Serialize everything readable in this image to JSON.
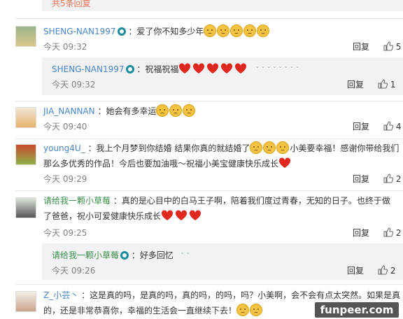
{
  "top": {
    "more": "共5条回复"
  },
  "comments": [
    {
      "user": "SHENG-NAN1997",
      "text": "：爱了你不知多少年",
      "time": "今天 09:32",
      "reply": "回复",
      "likes": "5"
    },
    {
      "user": "SHENG-NAN1997",
      "text": "：祝福祝福",
      "time": "今天 09:32",
      "reply": "回复",
      "likes": "1"
    },
    {
      "user": "JIA_NANNAN",
      "text": "：她会有多幸运",
      "time": "今天 09:40",
      "reply": "回复",
      "likes": "4"
    },
    {
      "user": "young4U_",
      "text1": "：我上个月梦到你结婚 结果你真的就结婚了",
      "text2": "小美要幸福！感谢你带给我们",
      "text3": "那么多优秀的作品！今后也要加油哦～祝福小美宝健康快乐成长",
      "time": "今天 09:29",
      "reply": "回复",
      "likes": "2"
    },
    {
      "user": "请给我一颗小草莓",
      "text1": "：真的是心目中的白马王子啊，陪着我们度过青春，无知的日子。也终于做",
      "text2": "了爸爸，祝小可爱健康快乐成长",
      "time": "今天 09:25",
      "reply": "回复",
      "likes": "2"
    },
    {
      "user": "请给我一颗小草莓",
      "text": "：好多回忆",
      "time": "今天 09:26",
      "reply": "回复",
      "likes": "2"
    },
    {
      "user": "Z_小芸丶",
      "text1": "：这是真的吗，是真的吗，真的吗，的吗，吗？小美啊，会不会有点太突然。如果是真",
      "text2": "的，还是非常恭喜你，幸福的生活会一直继续下去！"
    }
  ],
  "watermark": "funpeer.com",
  "colors": {
    "accent": "#eb7350",
    "username": "#4a86c8",
    "subbox": "#f2f2f5"
  }
}
